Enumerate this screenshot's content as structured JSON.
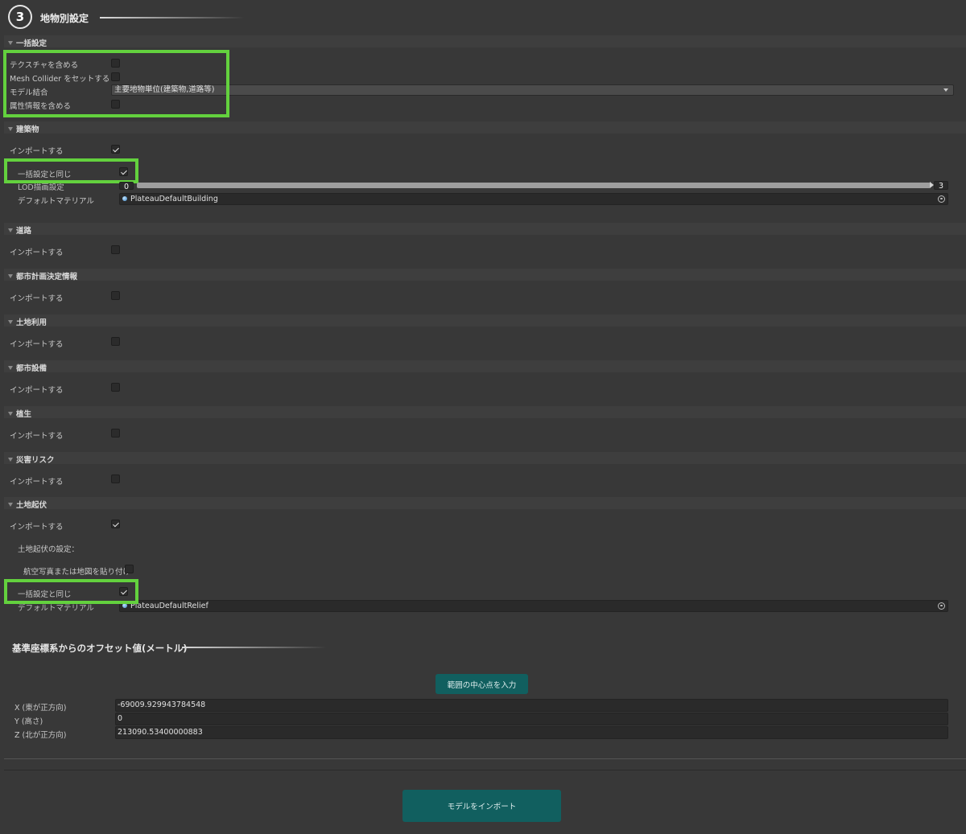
{
  "header": {
    "step_number": "3",
    "title": "地物別設定"
  },
  "bulk": {
    "section_title": "一括設定",
    "include_textures_label": "テクスチャを含める",
    "include_textures_checked": false,
    "mesh_collider_label": "Mesh Collider をセットする",
    "mesh_collider_checked": false,
    "model_merge_label": "モデル結合",
    "model_merge_value": "主要地物単位(建築物,道路等)",
    "attributes_label": "属性情報を含める",
    "attributes_checked": false
  },
  "building": {
    "section_title": "建築物",
    "import_label": "インポートする",
    "import_checked": true,
    "same_as_bulk_label": "一括設定と同じ",
    "same_as_bulk_checked": true,
    "lod_label": "LOD描画設定",
    "lod_min": "0",
    "lod_max": "3",
    "material_label": "デフォルトマテリアル",
    "material_value": "PlateauDefaultBuilding"
  },
  "road": {
    "section_title": "道路",
    "import_label": "インポートする",
    "import_checked": false
  },
  "urban_planning": {
    "section_title": "都市計画決定情報",
    "import_label": "インポートする",
    "import_checked": false
  },
  "land_use": {
    "section_title": "土地利用",
    "import_label": "インポートする",
    "import_checked": false
  },
  "city_facilities": {
    "section_title": "都市設備",
    "import_label": "インポートする",
    "import_checked": false
  },
  "vegetation": {
    "section_title": "植生",
    "import_label": "インポートする",
    "import_checked": false
  },
  "disaster_risk": {
    "section_title": "災害リスク",
    "import_label": "インポートする",
    "import_checked": false
  },
  "relief": {
    "section_title": "土地起伏",
    "import_label": "インポートする",
    "import_checked": true,
    "settings_label": "土地起伏の設定：",
    "aerial_label": "航空写真または地図を貼り付け",
    "aerial_checked": false,
    "same_as_bulk_label": "一括設定と同じ",
    "same_as_bulk_checked": true,
    "material_label": "デフォルトマテリアル",
    "material_value": "PlateauDefaultRelief"
  },
  "offset": {
    "title": "基準座標系からのオフセット値(メートル)",
    "center_button": "範囲の中心点を入力",
    "x_label": "X (東が正方向)",
    "x_value": "-69009.929943784548",
    "y_label": "Y (高さ)",
    "y_value": "0",
    "z_label": "Z (北が正方向)",
    "z_value": "213090.53400000883"
  },
  "footer": {
    "import_button": "モデルをインポート"
  },
  "colors": {
    "highlight": "#63d13e",
    "button_teal": "#115f5f",
    "panel_bg": "#383838"
  }
}
